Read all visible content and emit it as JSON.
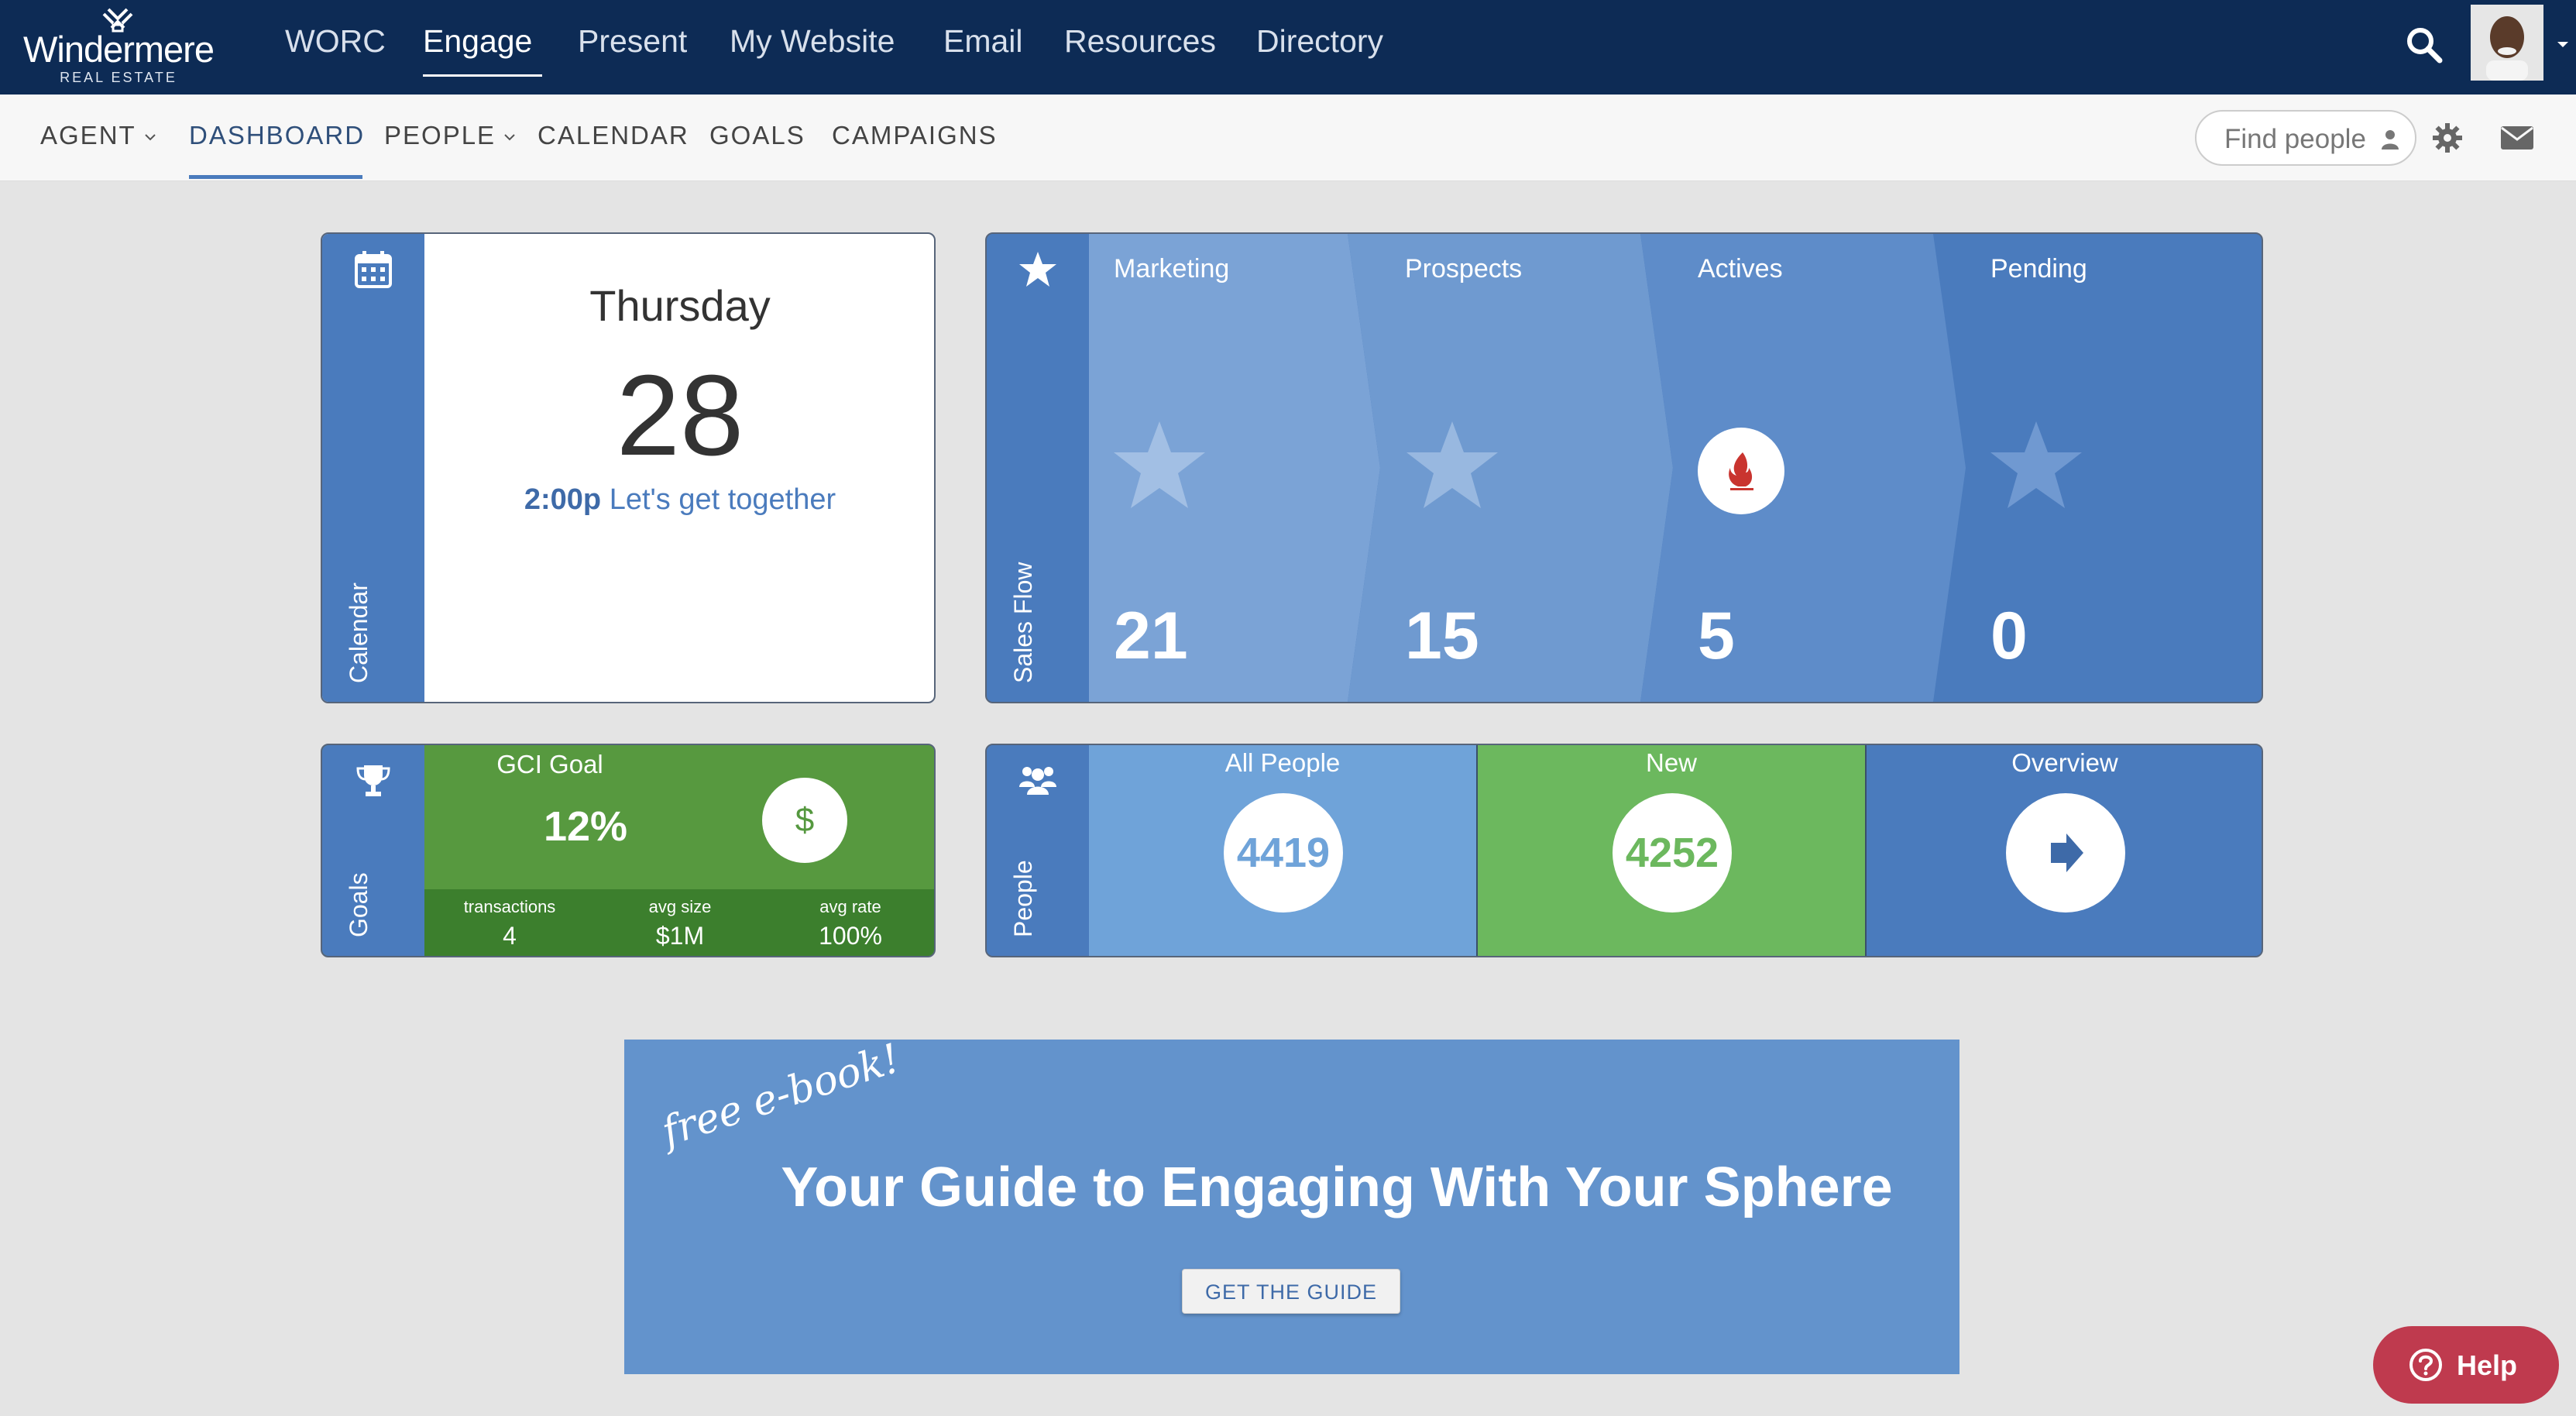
{
  "brand": {
    "name": "Windermere",
    "tagline": "REAL ESTATE"
  },
  "topnav": {
    "items": [
      {
        "label": "WORC"
      },
      {
        "label": "Engage"
      },
      {
        "label": "Present"
      },
      {
        "label": "My Website"
      },
      {
        "label": "Email"
      },
      {
        "label": "Resources"
      },
      {
        "label": "Directory"
      }
    ],
    "active": "Engage"
  },
  "subnav": {
    "items": [
      {
        "label": "AGENT"
      },
      {
        "label": "DASHBOARD"
      },
      {
        "label": "PEOPLE"
      },
      {
        "label": "CALENDAR"
      },
      {
        "label": "GOALS"
      },
      {
        "label": "CAMPAIGNS"
      }
    ],
    "active": "DASHBOARD",
    "search_placeholder": "Find people"
  },
  "calendar": {
    "side_label": "Calendar",
    "day": "Thursday",
    "date": "28",
    "event_time": "2:00p",
    "event_title": "Let's get together"
  },
  "sales_flow": {
    "side_label": "Sales Flow",
    "stages": [
      {
        "label": "Marketing",
        "count": "21",
        "icon": "star-icon"
      },
      {
        "label": "Prospects",
        "count": "15",
        "icon": "star-icon"
      },
      {
        "label": "Actives",
        "count": "5",
        "icon": "fire-icon"
      },
      {
        "label": "Pending",
        "count": "0",
        "icon": "star-icon"
      }
    ]
  },
  "goals": {
    "side_label": "Goals",
    "title": "GCI Goal",
    "percent": "12%",
    "dollar": "$",
    "stats": [
      {
        "label": "transactions",
        "value": "4"
      },
      {
        "label": "avg size",
        "value": "$1M"
      },
      {
        "label": "avg rate",
        "value": "100%"
      }
    ]
  },
  "people": {
    "side_label": "People",
    "all_label": "All People",
    "all_count": "4419",
    "new_label": "New",
    "new_count": "4252",
    "overview_label": "Overview"
  },
  "banner": {
    "free_text": "free e-book!",
    "title": "Your Guide to Engaging With Your Sphere",
    "button": "GET THE GUIDE"
  },
  "help": {
    "label": "Help"
  },
  "colors": {
    "topnav_bg": "#0d2b55",
    "accent_blue": "#4a7bbd",
    "goal_green": "#55983f",
    "new_green": "#6cb85e",
    "help_red": "#bf3a4e"
  }
}
